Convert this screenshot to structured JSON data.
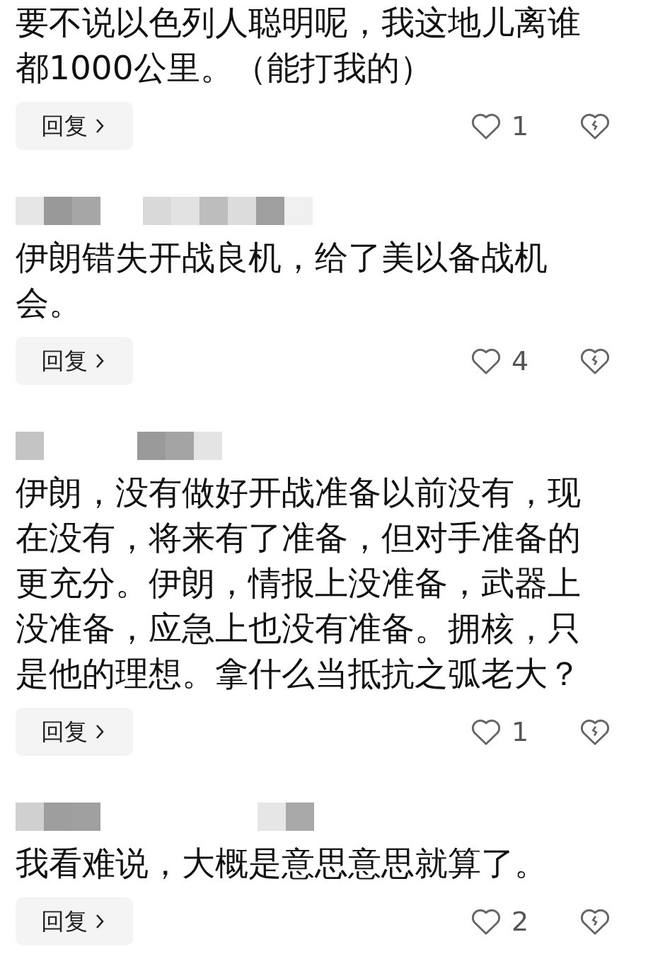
{
  "comments": [
    {
      "text": "要不说以色列人聪明呢，我这地儿离谁都1000公里。（能打我的）",
      "reply_label": "回复",
      "likes": "1"
    },
    {
      "author": {
        "kind": "blurred"
      },
      "text": "伊朗错失开战良机，给了美以备战机会。",
      "reply_label": "回复",
      "likes": "4"
    },
    {
      "author": {
        "kind": "blurred"
      },
      "text": "伊朗，没有做好开战准备以前没有，现在没有，将来有了准备，但对手准备的更充分。伊朗，情报上没准备，武器上没准备，应急上也没有准备。拥核，只是他的理想。拿什么当抵抗之弧老大？",
      "reply_label": "回复",
      "likes": "1"
    },
    {
      "author": {
        "kind": "blurred"
      },
      "text": "我看难说，大概是意思意思就算了。",
      "reply_label": "回复",
      "likes": "2"
    }
  ]
}
